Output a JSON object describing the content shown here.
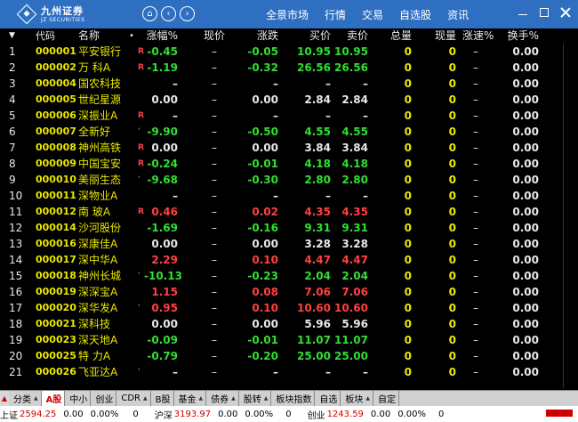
{
  "title_bar": {
    "logo_cn": "九州证券",
    "logo_en": "JZ SECURITIES",
    "home_glyph": "⌂",
    "back_glyph": "‹",
    "forward_glyph": "›",
    "menu": [
      "全景市场",
      "行情",
      "交易",
      "自选股",
      "资讯"
    ]
  },
  "header": {
    "sort_arrow": "▼",
    "code": "代码",
    "name": "名称",
    "dot": "•",
    "zf": "涨幅%",
    "xj": "现价",
    "zd": "涨跌",
    "buy": "买价",
    "sell": "卖价",
    "zl": "总量",
    "xl": "现量",
    "zs": "涨速%",
    "hs": "换手%"
  },
  "rows": [
    {
      "idx": "1",
      "code": "000001",
      "name": "平安银行",
      "flag": "R",
      "zf": "-0.45",
      "xj": "–",
      "zd": "-0.05",
      "buy": "10.95",
      "sell": "10.95",
      "zl": "0",
      "xl": "0",
      "zs": "–",
      "hs": "0.00",
      "dir": "down"
    },
    {
      "idx": "2",
      "code": "000002",
      "name": "万 科A",
      "flag": "R",
      "zf": "-1.19",
      "xj": "–",
      "zd": "-0.32",
      "buy": "26.56",
      "sell": "26.56",
      "zl": "0",
      "xl": "0",
      "zs": "–",
      "hs": "0.00",
      "dir": "down"
    },
    {
      "idx": "3",
      "code": "000004",
      "name": "国农科技",
      "flag": "",
      "zf": "–",
      "xj": "–",
      "zd": "–",
      "buy": "–",
      "sell": "–",
      "zl": "0",
      "xl": "0",
      "zs": "–",
      "hs": "0.00",
      "dir": "flat"
    },
    {
      "idx": "4",
      "code": "000005",
      "name": "世纪星源",
      "flag": "",
      "zf": "0.00",
      "xj": "–",
      "zd": "0.00",
      "buy": "2.84",
      "sell": "2.84",
      "zl": "0",
      "xl": "0",
      "zs": "–",
      "hs": "0.00",
      "dir": "flat"
    },
    {
      "idx": "5",
      "code": "000006",
      "name": "深振业A",
      "flag": "R",
      "zf": "–",
      "xj": "–",
      "zd": "–",
      "buy": "–",
      "sell": "–",
      "zl": "0",
      "xl": "0",
      "zs": "–",
      "hs": "0.00",
      "dir": "flat"
    },
    {
      "idx": "6",
      "code": "000007",
      "name": "全新好",
      "flag": "'",
      "zf": "-9.90",
      "xj": "–",
      "zd": "-0.50",
      "buy": "4.55",
      "sell": "4.55",
      "zl": "0",
      "xl": "0",
      "zs": "–",
      "hs": "0.00",
      "dir": "down"
    },
    {
      "idx": "7",
      "code": "000008",
      "name": "神州高铁",
      "flag": "R",
      "zf": "0.00",
      "xj": "–",
      "zd": "0.00",
      "buy": "3.84",
      "sell": "3.84",
      "zl": "0",
      "xl": "0",
      "zs": "–",
      "hs": "0.00",
      "dir": "flat"
    },
    {
      "idx": "8",
      "code": "000009",
      "name": "中国宝安",
      "flag": "R",
      "zf": "-0.24",
      "xj": "–",
      "zd": "-0.01",
      "buy": "4.18",
      "sell": "4.18",
      "zl": "0",
      "xl": "0",
      "zs": "–",
      "hs": "0.00",
      "dir": "down"
    },
    {
      "idx": "9",
      "code": "000010",
      "name": "美丽生态",
      "flag": "'",
      "zf": "-9.68",
      "xj": "–",
      "zd": "-0.30",
      "buy": "2.80",
      "sell": "2.80",
      "zl": "0",
      "xl": "0",
      "zs": "–",
      "hs": "0.00",
      "dir": "down"
    },
    {
      "idx": "10",
      "code": "000011",
      "name": "深物业A",
      "flag": "",
      "zf": "–",
      "xj": "–",
      "zd": "–",
      "buy": "–",
      "sell": "–",
      "zl": "0",
      "xl": "0",
      "zs": "–",
      "hs": "0.00",
      "dir": "flat"
    },
    {
      "idx": "11",
      "code": "000012",
      "name": "南 玻A",
      "flag": "R",
      "zf": "0.46",
      "xj": "–",
      "zd": "0.02",
      "buy": "4.35",
      "sell": "4.35",
      "zl": "0",
      "xl": "0",
      "zs": "–",
      "hs": "0.00",
      "dir": "up"
    },
    {
      "idx": "12",
      "code": "000014",
      "name": "沙河股份",
      "flag": "",
      "zf": "-1.69",
      "xj": "–",
      "zd": "-0.16",
      "buy": "9.31",
      "sell": "9.31",
      "zl": "0",
      "xl": "0",
      "zs": "–",
      "hs": "0.00",
      "dir": "down"
    },
    {
      "idx": "13",
      "code": "000016",
      "name": "深康佳A",
      "flag": "",
      "zf": "0.00",
      "xj": "–",
      "zd": "0.00",
      "buy": "3.28",
      "sell": "3.28",
      "zl": "0",
      "xl": "0",
      "zs": "–",
      "hs": "0.00",
      "dir": "flat"
    },
    {
      "idx": "14",
      "code": "000017",
      "name": "深中华A",
      "flag": "",
      "zf": "2.29",
      "xj": "–",
      "zd": "0.10",
      "buy": "4.47",
      "sell": "4.47",
      "zl": "0",
      "xl": "0",
      "zs": "–",
      "hs": "0.00",
      "dir": "up"
    },
    {
      "idx": "15",
      "code": "000018",
      "name": "神州长城",
      "flag": "'",
      "zf": "-10.13",
      "xj": "–",
      "zd": "-0.23",
      "buy": "2.04",
      "sell": "2.04",
      "zl": "0",
      "xl": "0",
      "zs": "–",
      "hs": "0.00",
      "dir": "down"
    },
    {
      "idx": "16",
      "code": "000019",
      "name": "深深宝A",
      "flag": "",
      "zf": "1.15",
      "xj": "–",
      "zd": "0.08",
      "buy": "7.06",
      "sell": "7.06",
      "zl": "0",
      "xl": "0",
      "zs": "–",
      "hs": "0.00",
      "dir": "up"
    },
    {
      "idx": "17",
      "code": "000020",
      "name": "深华发A",
      "flag": "'",
      "zf": "0.95",
      "xj": "–",
      "zd": "0.10",
      "buy": "10.60",
      "sell": "10.60",
      "zl": "0",
      "xl": "0",
      "zs": "–",
      "hs": "0.00",
      "dir": "up"
    },
    {
      "idx": "18",
      "code": "000021",
      "name": "深科技",
      "flag": "",
      "zf": "0.00",
      "xj": "–",
      "zd": "0.00",
      "buy": "5.96",
      "sell": "5.96",
      "zl": "0",
      "xl": "0",
      "zs": "–",
      "hs": "0.00",
      "dir": "flat"
    },
    {
      "idx": "19",
      "code": "000023",
      "name": "深天地A",
      "flag": "",
      "zf": "-0.09",
      "xj": "–",
      "zd": "-0.01",
      "buy": "11.07",
      "sell": "11.07",
      "zl": "0",
      "xl": "0",
      "zs": "–",
      "hs": "0.00",
      "dir": "down"
    },
    {
      "idx": "20",
      "code": "000025",
      "name": "特 力A",
      "flag": "",
      "zf": "-0.79",
      "xj": "–",
      "zd": "-0.20",
      "buy": "25.00",
      "sell": "25.00",
      "zl": "0",
      "xl": "0",
      "zs": "–",
      "hs": "0.00",
      "dir": "down"
    },
    {
      "idx": "21",
      "code": "000026",
      "name": "飞亚达A",
      "flag": "'",
      "zf": "–",
      "xj": "–",
      "zd": "–",
      "buy": "–",
      "sell": "–",
      "zl": "0",
      "xl": "0",
      "zs": "–",
      "hs": "0.00",
      "dir": "flat"
    }
  ],
  "tabs": [
    {
      "label": "分类",
      "tri": true,
      "active": false
    },
    {
      "label": "A股",
      "tri": false,
      "active": true
    },
    {
      "label": "中小",
      "tri": false,
      "active": false
    },
    {
      "label": "创业",
      "tri": false,
      "active": false
    },
    {
      "label": "CDR",
      "tri": true,
      "active": false
    },
    {
      "label": "B股",
      "tri": false,
      "active": false
    },
    {
      "label": "基金",
      "tri": true,
      "active": false
    },
    {
      "label": "债券",
      "tri": true,
      "active": false
    },
    {
      "label": "股转",
      "tri": true,
      "active": false
    },
    {
      "label": "板块指数",
      "tri": false,
      "active": false
    },
    {
      "label": "自选",
      "tri": false,
      "active": false
    },
    {
      "label": "板块",
      "tri": true,
      "active": false
    },
    {
      "label": "自定",
      "tri": false,
      "active": false
    }
  ],
  "status_bar": {
    "sh_label": "上证",
    "sh_value": "2594.25",
    "sh_change": "0.00",
    "sh_pct": "0.00%",
    "sh_vol": "0",
    "hs_label": "沪深",
    "hs_value": "3193.97",
    "hs_change": "0.00",
    "hs_pct": "0.00%",
    "hs_vol": "0",
    "cy_label": "创业",
    "cy_value": "1243.59",
    "cy_change": "0.00",
    "cy_pct": "0.00%",
    "cy_vol": "0"
  },
  "colors": {
    "title_bg": "#2f6fc2",
    "up": "#ff4040",
    "down": "#33dd33",
    "code": "#e8e800"
  }
}
